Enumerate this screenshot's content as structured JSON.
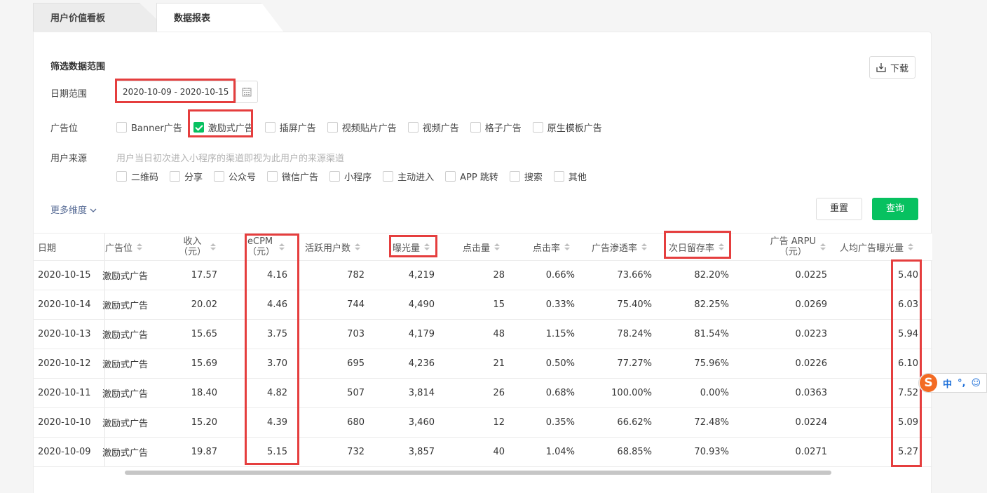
{
  "tabs": [
    {
      "label": "用户价值看板"
    },
    {
      "label": "数据报表"
    }
  ],
  "filters": {
    "title": "筛选数据范围",
    "download_label": "下载",
    "date_label": "日期范围",
    "date_value": "2020-10-09 - 2020-10-15",
    "ad_slot_label": "广告位",
    "ad_slots": [
      {
        "label": "Banner广告",
        "checked": false
      },
      {
        "label": "激励式广告",
        "checked": true
      },
      {
        "label": "插屏广告",
        "checked": false
      },
      {
        "label": "视频贴片广告",
        "checked": false
      },
      {
        "label": "视频广告",
        "checked": false
      },
      {
        "label": "格子广告",
        "checked": false
      },
      {
        "label": "原生模板广告",
        "checked": false
      }
    ],
    "source_label": "用户来源",
    "source_hint": "用户当日初次进入小程序的渠道即视为此用户的来源渠道",
    "sources": [
      {
        "label": "二维码",
        "checked": false
      },
      {
        "label": "分享",
        "checked": false
      },
      {
        "label": "公众号",
        "checked": false
      },
      {
        "label": "微信广告",
        "checked": false
      },
      {
        "label": "小程序",
        "checked": false
      },
      {
        "label": "主动进入",
        "checked": false
      },
      {
        "label": "APP 跳转",
        "checked": false
      },
      {
        "label": "搜索",
        "checked": false
      },
      {
        "label": "其他",
        "checked": false
      }
    ],
    "more_label": "更多维度",
    "reset_label": "重置",
    "query_label": "查询"
  },
  "table": {
    "headers": {
      "date": "日期",
      "slot": "广告位",
      "income_1": "收入",
      "income_2": "（元）",
      "ecpm_1": "eCPM",
      "ecpm_2": "（元）",
      "active": "活跃用户数",
      "exposure": "曝光量",
      "clicks": "点击量",
      "ctr": "点击率",
      "penetration": "广告渗透率",
      "retention": "次日留存率",
      "arpu_1": "广告 ARPU",
      "arpu_2": "（元）",
      "per_user": "人均广告曝光量"
    },
    "rows": [
      {
        "date": "2020-10-15",
        "slot": "激励式广告",
        "income": "17.57",
        "ecpm": "4.16",
        "active": "782",
        "exposure": "4,219",
        "clicks": "28",
        "ctr": "0.66%",
        "penetration": "73.66%",
        "retention": "82.20%",
        "arpu": "0.0225",
        "per_user": "5.40"
      },
      {
        "date": "2020-10-14",
        "slot": "激励式广告",
        "income": "20.02",
        "ecpm": "4.46",
        "active": "744",
        "exposure": "4,490",
        "clicks": "15",
        "ctr": "0.33%",
        "penetration": "75.40%",
        "retention": "82.25%",
        "arpu": "0.0269",
        "per_user": "6.03"
      },
      {
        "date": "2020-10-13",
        "slot": "激励式广告",
        "income": "15.65",
        "ecpm": "3.75",
        "active": "703",
        "exposure": "4,179",
        "clicks": "48",
        "ctr": "1.15%",
        "penetration": "78.24%",
        "retention": "81.54%",
        "arpu": "0.0223",
        "per_user": "5.94"
      },
      {
        "date": "2020-10-12",
        "slot": "激励式广告",
        "income": "15.69",
        "ecpm": "3.70",
        "active": "695",
        "exposure": "4,236",
        "clicks": "21",
        "ctr": "0.50%",
        "penetration": "77.27%",
        "retention": "75.96%",
        "arpu": "0.0226",
        "per_user": "6.10"
      },
      {
        "date": "2020-10-11",
        "slot": "激励式广告",
        "income": "18.40",
        "ecpm": "4.82",
        "active": "507",
        "exposure": "3,814",
        "clicks": "26",
        "ctr": "0.68%",
        "penetration": "100.00%",
        "retention": "0.00%",
        "arpu": "0.0363",
        "per_user": "7.52"
      },
      {
        "date": "2020-10-10",
        "slot": "激励式广告",
        "income": "15.20",
        "ecpm": "4.39",
        "active": "680",
        "exposure": "3,460",
        "clicks": "12",
        "ctr": "0.35%",
        "penetration": "66.62%",
        "retention": "72.48%",
        "arpu": "0.0224",
        "per_user": "5.09"
      },
      {
        "date": "2020-10-09",
        "slot": "激励式广告",
        "income": "19.87",
        "ecpm": "5.15",
        "active": "732",
        "exposure": "3,857",
        "clicks": "40",
        "ctr": "1.04%",
        "penetration": "68.85%",
        "retention": "70.93%",
        "arpu": "0.0271",
        "per_user": "5.27"
      }
    ]
  },
  "ime": {
    "logo": "S",
    "lang": "中",
    "punct": "°,",
    "emoji": "☺"
  }
}
